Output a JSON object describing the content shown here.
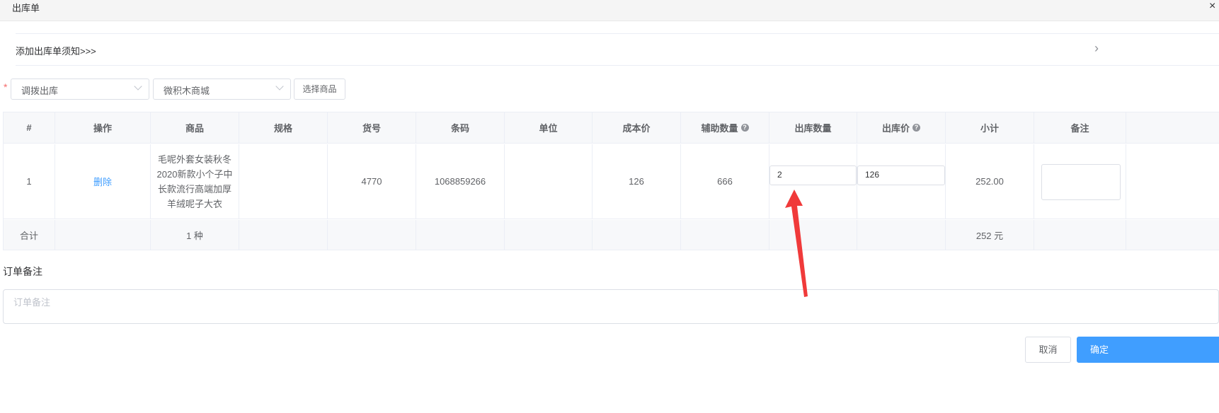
{
  "dialog": {
    "title": "出库单",
    "close_glyph": "×"
  },
  "notice": {
    "text": "添加出库单须知>>>",
    "arrow_glyph": "›"
  },
  "form": {
    "required_mark": "*",
    "type_select": {
      "value": "调拨出库"
    },
    "store_select": {
      "value": "微积木商城"
    },
    "choose_goods_label": "选择商品"
  },
  "table": {
    "headers": {
      "index": "#",
      "op": "操作",
      "goods": "商品",
      "spec": "规格",
      "item_no": "货号",
      "barcode": "条码",
      "unit": "单位",
      "cost": "成本价",
      "aux_qty": "辅助数量",
      "out_qty": "出库数量",
      "out_price": "出库价",
      "subtotal": "小计",
      "memo": "备注"
    },
    "help_glyph": "?",
    "row": {
      "index": "1",
      "op": "删除",
      "goods": "毛呢外套女装秋冬2020新款小个子中长款流行高端加厚羊绒呢子大衣",
      "spec": "",
      "item_no": "4770",
      "barcode": "1068859266",
      "unit": "",
      "cost": "126",
      "aux_qty": "666",
      "out_qty": "2",
      "out_price": "126",
      "subtotal": "252.00",
      "memo": ""
    },
    "total": {
      "label": "合计",
      "goods": "1 种",
      "subtotal": "252 元"
    }
  },
  "order_memo": {
    "label": "订单备注",
    "placeholder": "订单备注"
  },
  "footer": {
    "cancel_label": "取消",
    "confirm_label": "确定"
  },
  "colors": {
    "primary": "#409eff",
    "required": "#f56c6c",
    "annotation_arrow": "#f03a3a"
  }
}
